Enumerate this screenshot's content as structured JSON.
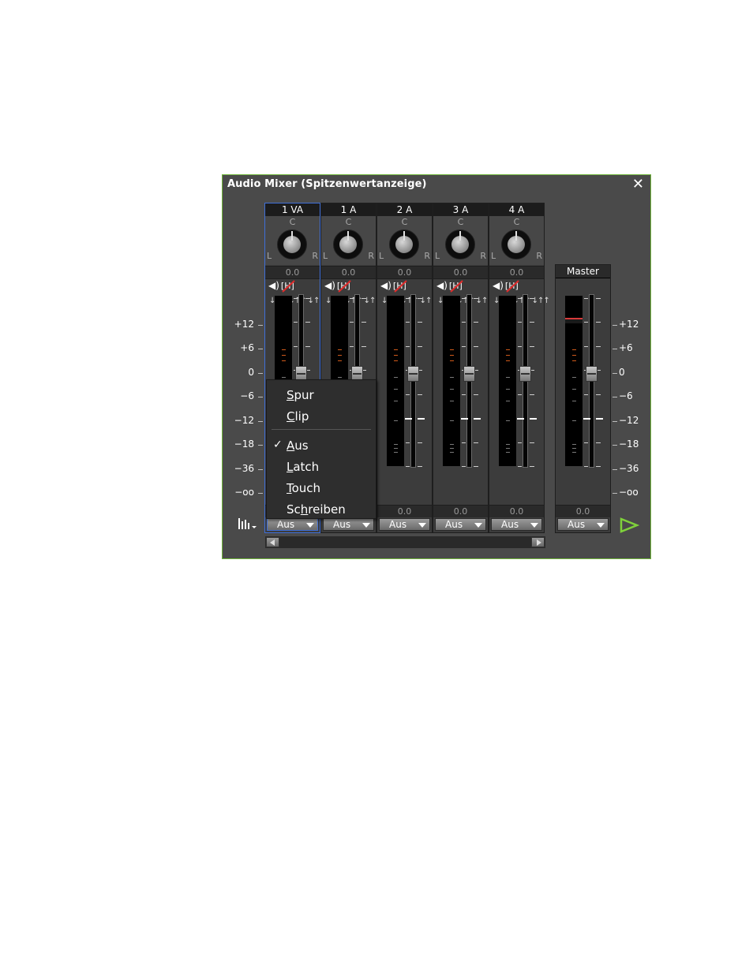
{
  "window": {
    "title": "Audio Mixer (Spitzenwertanzeige)",
    "close_glyph": "✕"
  },
  "channels": [
    {
      "name": "1 VA",
      "pan_value": "0.0",
      "volume": "0.0",
      "automation": "Aus",
      "selected": true
    },
    {
      "name": "1 A",
      "pan_value": "0.0",
      "volume": "0.0",
      "automation": "Aus",
      "selected": false
    },
    {
      "name": "2 A",
      "pan_value": "0.0",
      "volume": "0.0",
      "automation": "Aus",
      "selected": false
    },
    {
      "name": "3 A",
      "pan_value": "0.0",
      "volume": "0.0",
      "automation": "Aus",
      "selected": false
    },
    {
      "name": "4 A",
      "pan_value": "0.0",
      "volume": "0.0",
      "automation": "Aus",
      "selected": false
    }
  ],
  "pan_labels": {
    "center": "C",
    "left": "L",
    "right": "R"
  },
  "master": {
    "name": "Master",
    "volume": "0.0",
    "automation": "Aus"
  },
  "scale": [
    "+12",
    "+6",
    "0",
    "−6",
    "−12",
    "−18",
    "−36",
    "−oo"
  ],
  "automation_menu": {
    "items": [
      {
        "label": "Spur",
        "accel": "S",
        "rest": "pur",
        "checked": false
      },
      {
        "label": "Clip",
        "accel": "C",
        "rest": "lip",
        "checked": false
      },
      {
        "label": "Aus",
        "accel": "A",
        "rest": "us",
        "checked": true
      },
      {
        "label": "Latch",
        "accel": "L",
        "rest": "atch",
        "checked": false
      },
      {
        "label": "Touch",
        "accel": "T",
        "rest": "ouch",
        "checked": false
      },
      {
        "label": "Schreiben",
        "pre": "Sc",
        "accel": "h",
        "rest": "reiben",
        "checked": false
      }
    ],
    "check_glyph": "✓"
  },
  "icons": [
    "speaker-icon",
    "solo-mute-icon",
    "route-icons",
    "mixer-options-icon",
    "play-output-icon"
  ],
  "colors": {
    "frame": "#6fb43a",
    "selection": "#3f6fd8",
    "background": "#4a4a4a",
    "play": "#7fd13b"
  }
}
